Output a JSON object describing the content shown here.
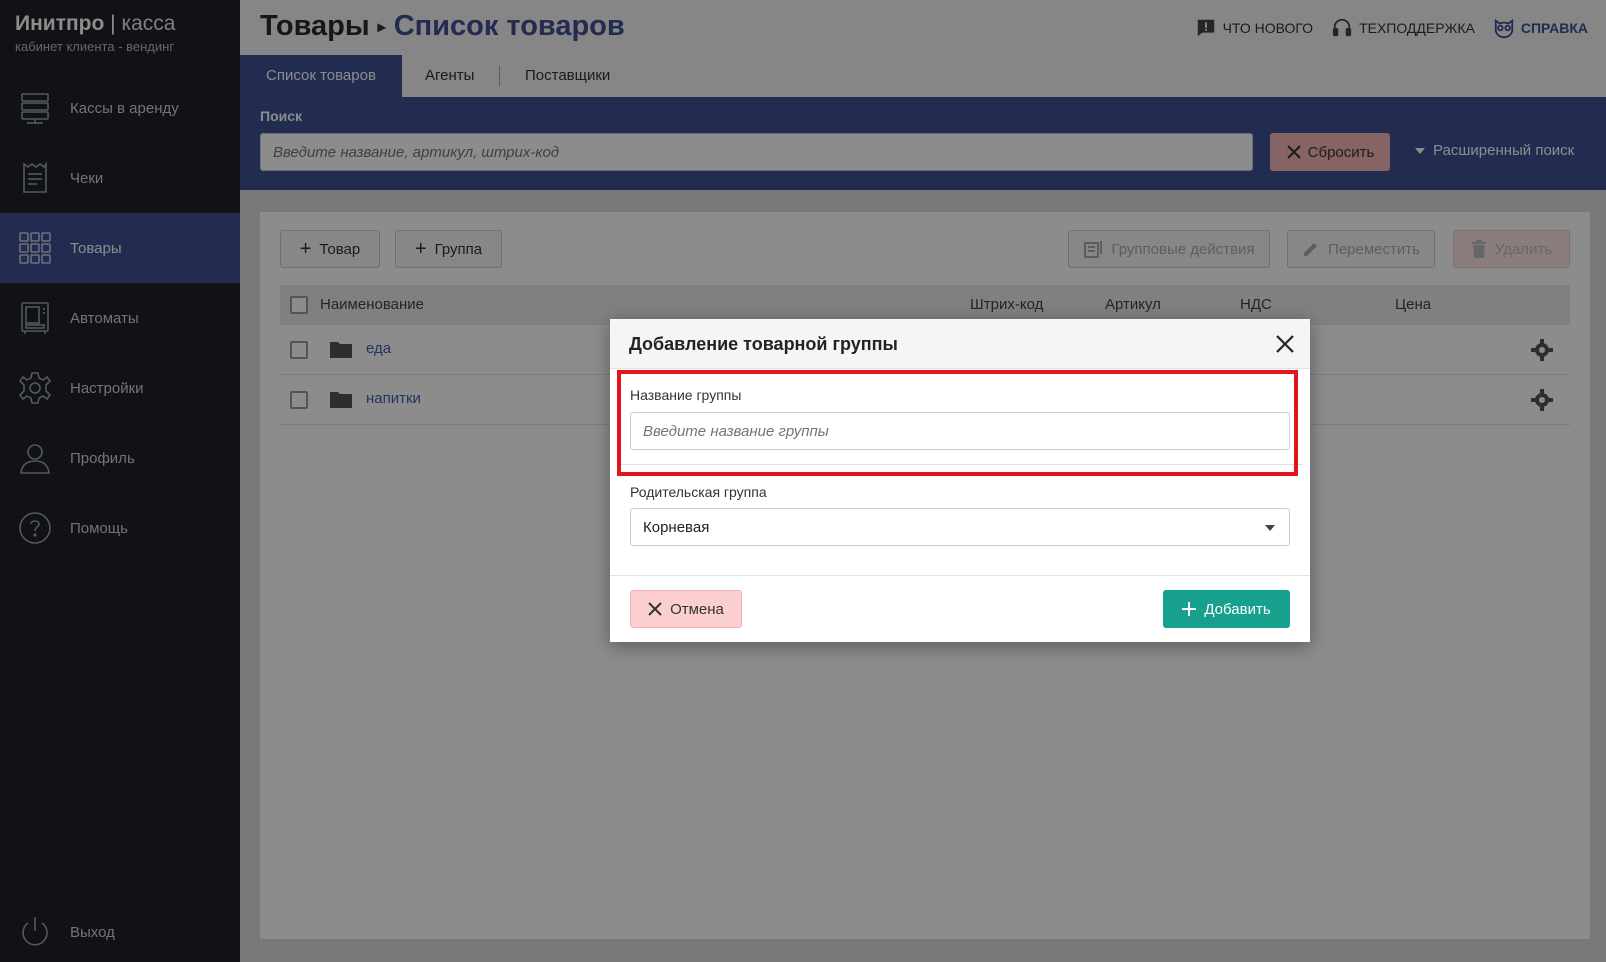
{
  "brand": {
    "name_bold": "Инитпро",
    "name_sep": " | ",
    "name_light": "касса",
    "subtitle": "кабинет клиента - вендинг"
  },
  "sidebar": {
    "items": [
      {
        "label": "Кассы в аренду",
        "icon": "server-icon",
        "active": false
      },
      {
        "label": "Чеки",
        "icon": "receipt-icon",
        "active": false
      },
      {
        "label": "Товары",
        "icon": "grid-icon",
        "active": true
      },
      {
        "label": "Автоматы",
        "icon": "vending-machine-icon",
        "active": false
      },
      {
        "label": "Настройки",
        "icon": "gear-icon",
        "active": false
      },
      {
        "label": "Профиль",
        "icon": "user-icon",
        "active": false
      },
      {
        "label": "Помощь",
        "icon": "question-icon",
        "active": false
      }
    ],
    "logout": "Выход"
  },
  "header": {
    "breadcrumb_root": "Товары",
    "breadcrumb_current": "Список товаров",
    "links": {
      "news": "Что нового",
      "support": "Техподдержка",
      "help": "Справка"
    }
  },
  "tabs": [
    "Список товаров",
    "Агенты",
    "Поставщики"
  ],
  "search": {
    "label": "Поиск",
    "placeholder": "Введите название, артикул, штрих-код",
    "reset_label": "Сбросить",
    "advanced_label": "Расширенный поиск"
  },
  "toolbar": {
    "add_product": "Товар",
    "add_group": "Группа",
    "group_actions": "Групповые действия",
    "move": "Переместить",
    "delete": "Удалить"
  },
  "table": {
    "columns": {
      "name": "Наименование",
      "barcode": "Штрих-код",
      "article": "Артикул",
      "vat": "НДС",
      "price": "Цена"
    },
    "rows": [
      {
        "name": "еда"
      },
      {
        "name": "напитки"
      }
    ]
  },
  "modal": {
    "title": "Добавление товарной группы",
    "group_name_label": "Название группы",
    "group_name_placeholder": "Введите название группы",
    "parent_label": "Родительская группа",
    "parent_value": "Корневая",
    "cancel_label": "Отмена",
    "add_label": "Добавить"
  },
  "colors": {
    "accent": "#3f4f93",
    "add_button": "#17a08e",
    "highlight": "#e3141b",
    "sidebar": "#1f2228"
  }
}
